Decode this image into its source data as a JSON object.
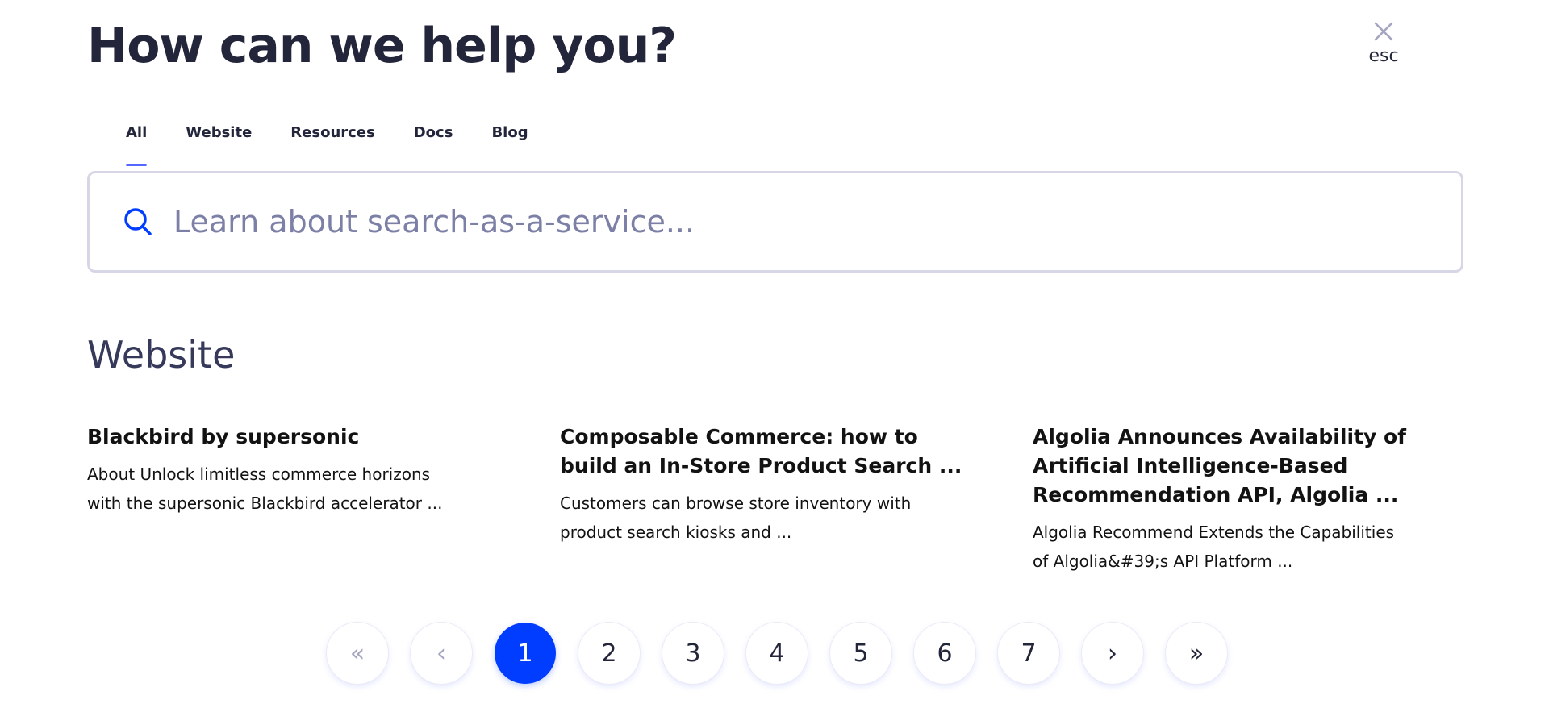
{
  "header": {
    "title": "How can we help you?",
    "close_label": "esc"
  },
  "tabs": [
    {
      "label": "All",
      "active": true
    },
    {
      "label": "Website",
      "active": false
    },
    {
      "label": "Resources",
      "active": false
    },
    {
      "label": "Docs",
      "active": false
    },
    {
      "label": "Blog",
      "active": false
    }
  ],
  "search": {
    "value": "",
    "placeholder": "Learn about search-as-a-service..."
  },
  "section": {
    "title": "Website"
  },
  "results": [
    {
      "title": "Blackbird by supersonic",
      "description": "About Unlock limitless commerce horizons with the supersonic Blackbird accelerator ..."
    },
    {
      "title": "Composable Commerce: how to build an In-Store Product Search ...",
      "description": "Customers can browse store inventory with product search kiosks and ..."
    },
    {
      "title": "Algolia Announces Availability of Artificial Intelligence-Based Recommendation API, Algolia ...",
      "description": "Algolia Recommend Extends the Capabilities of Algolia&#39;s API Platform ..."
    }
  ],
  "pagination": {
    "first": "«",
    "prev": "‹",
    "pages": [
      "1",
      "2",
      "3",
      "4",
      "5",
      "6",
      "7"
    ],
    "current": "1",
    "next": "›",
    "last": "»"
  },
  "colors": {
    "accent": "#003dff",
    "tab_underline": "#5468ff",
    "text_dark": "#23263b",
    "placeholder": "#7d80a6",
    "border": "#d6d6e7"
  },
  "icons": {
    "close": "close-icon",
    "search": "search-icon"
  }
}
